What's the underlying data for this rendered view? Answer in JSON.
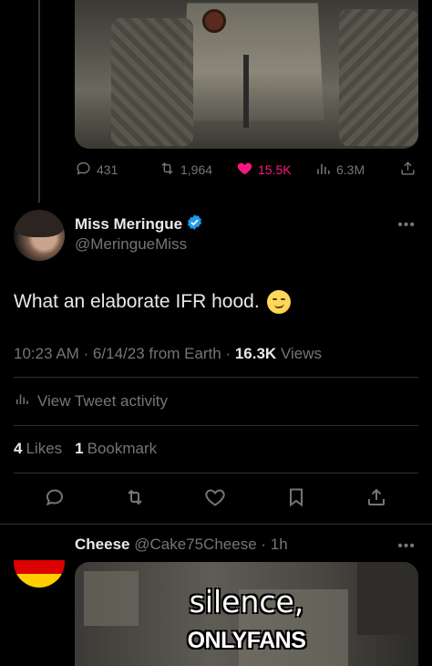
{
  "parent_tweet": {
    "stats": {
      "replies": "431",
      "retweets": "1,964",
      "likes": "15.5K",
      "views": "6.3M"
    },
    "like_color": "#f91880"
  },
  "main_tweet": {
    "display_name": "Miss Meringue",
    "handle": "@MeringueMiss",
    "verified_color": "#1d9bf0",
    "text": "What an elaborate IFR hood.",
    "emoji": "smirk-emoji",
    "timestamp": "10:23 AM · 6/14/23 from Earth · ",
    "views_count": "16.3K",
    "views_label": " Views",
    "activity_label": "View Tweet activity",
    "likes_count": "4",
    "likes_label": "Likes",
    "bookmarks_count": "1",
    "bookmarks_label": "Bookmark",
    "actions": [
      "reply-icon",
      "retweet-icon",
      "like-icon",
      "bookmark-icon",
      "share-icon"
    ]
  },
  "reply_tweet": {
    "display_name": "Cheese",
    "handle_time": " @Cake75Cheese · 1h",
    "avatar": "germany-flag",
    "media_caption_line1": "silence,",
    "media_caption_line2": "ONLYFANS"
  },
  "colors": {
    "background": "#000000",
    "primary_text": "#e7e9ea",
    "secondary_text": "#71767b",
    "divider": "#2f3336"
  }
}
